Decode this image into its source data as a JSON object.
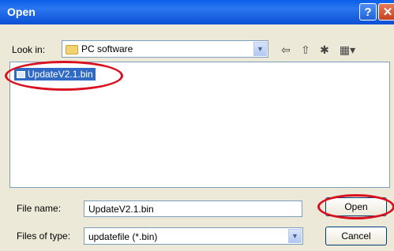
{
  "dialog": {
    "title": "Open",
    "help_glyph": "?",
    "close_glyph": "✕"
  },
  "lookin": {
    "label": "Look in:",
    "value": "PC software"
  },
  "toolbar": {
    "back_glyph": "⇦",
    "up_glyph": "⇧",
    "newfolder_glyph": "✱",
    "view_glyph": "▦▾"
  },
  "files": [
    {
      "name": "UpdateV2.1.bin",
      "selected": true
    }
  ],
  "filename": {
    "label": "File name:",
    "value": "UpdateV2.1.bin"
  },
  "filetype": {
    "label": "Files of type:",
    "value": "updatefile (*.bin)"
  },
  "buttons": {
    "open": "Open",
    "cancel": "Cancel"
  },
  "colors": {
    "title_bar": "#0a5fe8",
    "selection": "#316ac5",
    "highlight_ring": "#d9101e"
  },
  "icons": [
    "help-icon",
    "close-icon",
    "folder-icon",
    "back-icon",
    "up-folder-icon",
    "new-folder-icon",
    "view-menu-icon",
    "file-icon",
    "dropdown-arrow-icon"
  ]
}
